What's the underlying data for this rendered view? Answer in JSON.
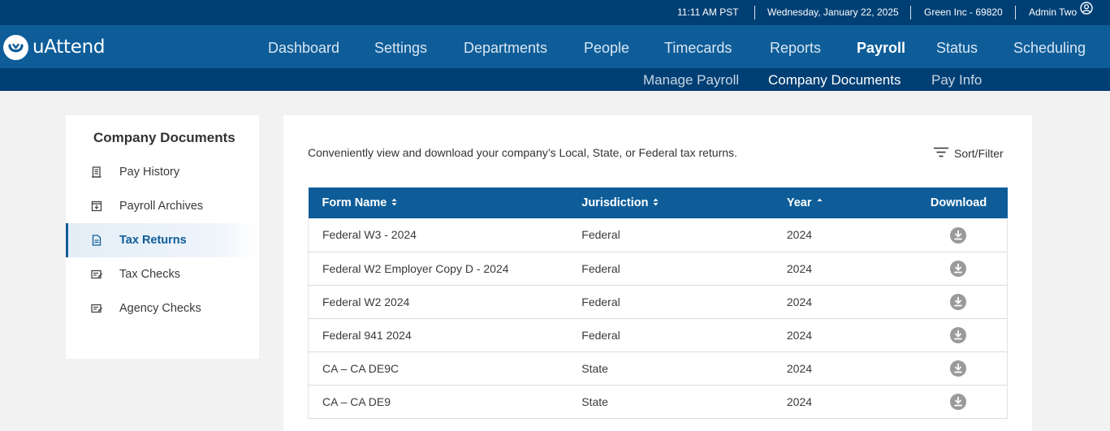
{
  "topbar": {
    "time": "11:11 AM PST",
    "date": "Wednesday, January 22, 2025",
    "company": "Green Inc - 69820",
    "user": "Admin Two",
    "user_icon": "user-circle-icon"
  },
  "logo": {
    "text": "uAttend",
    "icon": "uattend-logo-icon"
  },
  "nav": {
    "items": [
      {
        "label": "Dashboard"
      },
      {
        "label": "Settings"
      },
      {
        "label": "Departments"
      },
      {
        "label": "People"
      },
      {
        "label": "Timecards"
      },
      {
        "label": "Reports"
      },
      {
        "label": "Payroll",
        "active": true
      },
      {
        "label": "Status"
      },
      {
        "label": "Scheduling"
      }
    ]
  },
  "subnav": {
    "items": [
      {
        "label": "Manage Payroll"
      },
      {
        "label": "Company Documents",
        "active": true
      },
      {
        "label": "Pay Info"
      }
    ]
  },
  "sidebar": {
    "title": "Company Documents",
    "items": [
      {
        "label": "Pay History",
        "icon": "receipt-icon"
      },
      {
        "label": "Payroll Archives",
        "icon": "archive-icon"
      },
      {
        "label": "Tax Returns",
        "icon": "document-icon",
        "active": true
      },
      {
        "label": "Tax Checks",
        "icon": "check-icon"
      },
      {
        "label": "Agency Checks",
        "icon": "check-icon"
      }
    ]
  },
  "main": {
    "intro": "Conveniently view and download your company’s Local, State, or Federal tax returns.",
    "sort_filter_label": "Sort/Filter",
    "sort_filter_icon": "filter-icon",
    "table": {
      "columns": [
        "Form Name",
        "Jurisdiction",
        "Year",
        "Download"
      ],
      "rows": [
        {
          "form": "Federal W3 - 2024",
          "jurisdiction": "Federal",
          "year": "2024"
        },
        {
          "form": "Federal W2 Employer Copy D - 2024",
          "jurisdiction": "Federal",
          "year": "2024"
        },
        {
          "form": "Federal W2 2024",
          "jurisdiction": "Federal",
          "year": "2024"
        },
        {
          "form": "Federal 941 2024",
          "jurisdiction": "Federal",
          "year": "2024"
        },
        {
          "form": "CA – CA DE9C",
          "jurisdiction": "State",
          "year": "2024"
        },
        {
          "form": "CA – CA DE9",
          "jurisdiction": "State",
          "year": "2024"
        }
      ],
      "download_icon": "download-icon"
    }
  },
  "colors": {
    "nav_dark": "#003f74",
    "nav_primary": "#0e5d99",
    "background": "#f2f2f2",
    "download_icon": "#9a9a9a"
  }
}
